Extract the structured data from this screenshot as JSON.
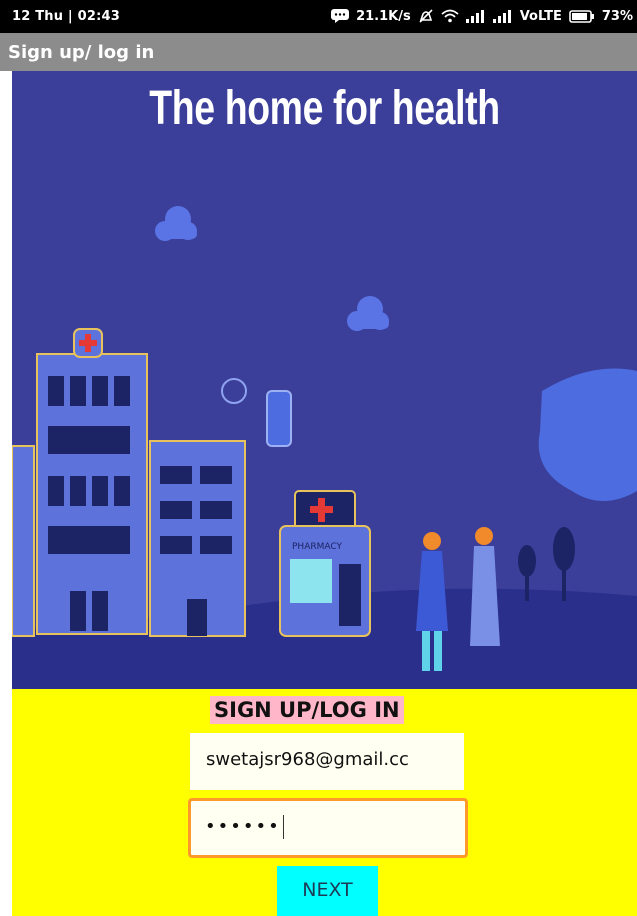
{
  "status_bar": {
    "date_time": "12 Thu | 02:43",
    "net_speed": "21.1K/s",
    "network_label": "VoLTE",
    "battery_percent": "73%"
  },
  "app_bar": {
    "title": "Sign up/ log in"
  },
  "hero": {
    "title": "The home for health",
    "sign_text": "PHARMACY"
  },
  "form": {
    "heading": "SIGN UP/LOG IN",
    "email_value": "swetajsr968@gmail.cc",
    "password_masked": "••••••",
    "next_label": "NEXT"
  },
  "colors": {
    "hero_background": "#3b3f99",
    "form_background": "#ffff00",
    "heading_highlight": "#ffb6c8",
    "focused_border": "#ff9a2a",
    "button_background": "#00ffff"
  },
  "icons": [
    "chat-bubble-icon",
    "mute-icon",
    "wifi-icon",
    "signal-icon",
    "battery-icon"
  ]
}
